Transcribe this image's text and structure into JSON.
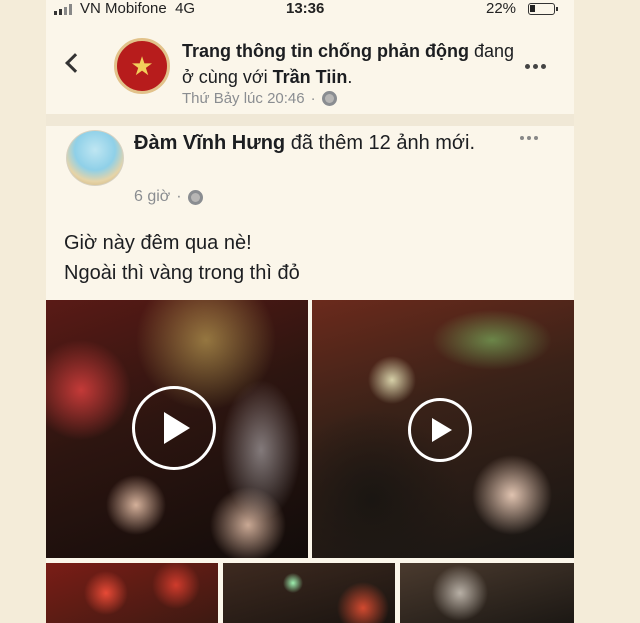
{
  "status_bar": {
    "carrier": "VN Mobifone",
    "network": "4G",
    "time": "13:36",
    "battery_percent": "22%",
    "battery_level": 0.22
  },
  "header": {
    "page_name": "Trang thông tin chống phản động",
    "with_text": " đang ở cùng với ",
    "tagged_name": "Trần Tiin",
    "tagged_suffix": ".",
    "timestamp": "Thứ Bảy lúc 20:46",
    "separator": "·"
  },
  "shared_post": {
    "author": "Đàm Vĩnh Hưng",
    "action": " đã thêm 12 ảnh mới.",
    "timestamp": "6 giờ",
    "separator": "·",
    "caption_lines": [
      "Giờ này đêm qua nè!",
      "Ngoài thì vàng trong thì đỏ"
    ]
  },
  "icons": {
    "back": "back-chevron-icon",
    "more": "more-options-icon",
    "audience": "globe-icon",
    "play": "play-icon",
    "logo": "police-star-emblem"
  },
  "colors": {
    "background": "#fbf6ea",
    "text": "#1c1e21",
    "meta": "#8a8d91",
    "logo_red": "#b71c1c"
  }
}
